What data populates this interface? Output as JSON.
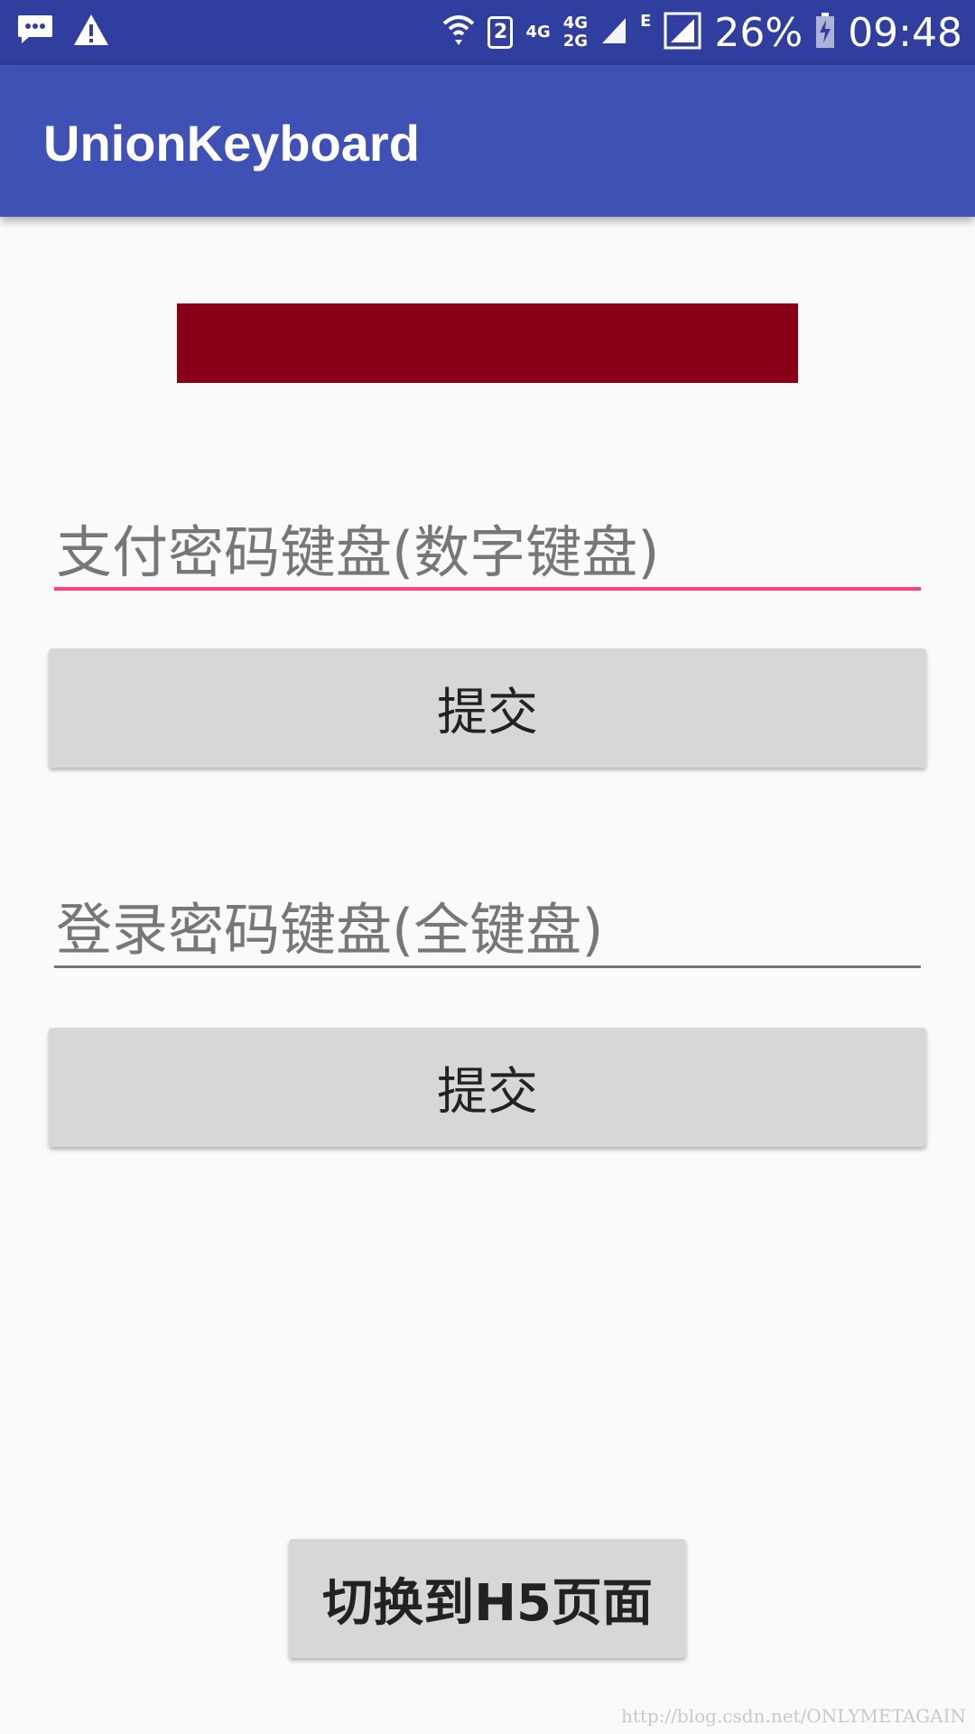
{
  "status_bar": {
    "sim_slot": "2",
    "network_labels": [
      "4G",
      "4G",
      "2G",
      "E"
    ],
    "battery_percent": "26%",
    "time": "09:48"
  },
  "app_bar": {
    "title": "UnionKeyboard"
  },
  "form": {
    "payment_password": {
      "placeholder": "支付密码键盘(数字键盘)",
      "value": ""
    },
    "submit_1_label": "提交",
    "login_password": {
      "placeholder": "登录密码键盘(全键盘)",
      "value": ""
    },
    "submit_2_label": "提交"
  },
  "switch_button_label": "切换到H5页面",
  "watermark": "http://blog.csdn.net/ONLYMETAGAIN",
  "colors": {
    "status_bar": "#303f9f",
    "app_bar": "#3f51b5",
    "accent": "#ff4081",
    "red_block": "#870017"
  },
  "icons": [
    "message-icon",
    "warning-icon",
    "wifi-icon",
    "signal-icon",
    "battery-charging-icon"
  ]
}
